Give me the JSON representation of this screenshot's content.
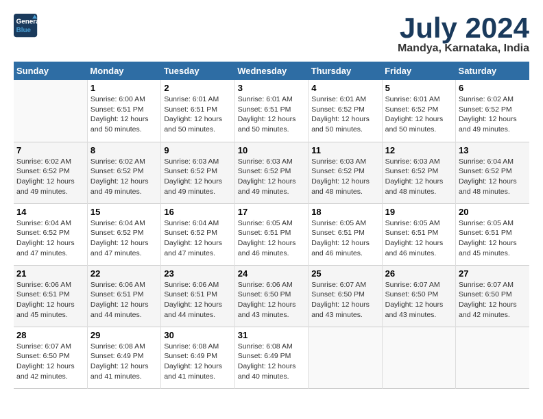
{
  "header": {
    "logo_line1": "General",
    "logo_line2": "Blue",
    "month": "July 2024",
    "location": "Mandya, Karnataka, India"
  },
  "days_of_week": [
    "Sunday",
    "Monday",
    "Tuesday",
    "Wednesday",
    "Thursday",
    "Friday",
    "Saturday"
  ],
  "weeks": [
    [
      {
        "day": "",
        "info": ""
      },
      {
        "day": "1",
        "info": "Sunrise: 6:00 AM\nSunset: 6:51 PM\nDaylight: 12 hours\nand 50 minutes."
      },
      {
        "day": "2",
        "info": "Sunrise: 6:01 AM\nSunset: 6:51 PM\nDaylight: 12 hours\nand 50 minutes."
      },
      {
        "day": "3",
        "info": "Sunrise: 6:01 AM\nSunset: 6:51 PM\nDaylight: 12 hours\nand 50 minutes."
      },
      {
        "day": "4",
        "info": "Sunrise: 6:01 AM\nSunset: 6:52 PM\nDaylight: 12 hours\nand 50 minutes."
      },
      {
        "day": "5",
        "info": "Sunrise: 6:01 AM\nSunset: 6:52 PM\nDaylight: 12 hours\nand 50 minutes."
      },
      {
        "day": "6",
        "info": "Sunrise: 6:02 AM\nSunset: 6:52 PM\nDaylight: 12 hours\nand 49 minutes."
      }
    ],
    [
      {
        "day": "7",
        "info": "Sunrise: 6:02 AM\nSunset: 6:52 PM\nDaylight: 12 hours\nand 49 minutes."
      },
      {
        "day": "8",
        "info": "Sunrise: 6:02 AM\nSunset: 6:52 PM\nDaylight: 12 hours\nand 49 minutes."
      },
      {
        "day": "9",
        "info": "Sunrise: 6:03 AM\nSunset: 6:52 PM\nDaylight: 12 hours\nand 49 minutes."
      },
      {
        "day": "10",
        "info": "Sunrise: 6:03 AM\nSunset: 6:52 PM\nDaylight: 12 hours\nand 49 minutes."
      },
      {
        "day": "11",
        "info": "Sunrise: 6:03 AM\nSunset: 6:52 PM\nDaylight: 12 hours\nand 48 minutes."
      },
      {
        "day": "12",
        "info": "Sunrise: 6:03 AM\nSunset: 6:52 PM\nDaylight: 12 hours\nand 48 minutes."
      },
      {
        "day": "13",
        "info": "Sunrise: 6:04 AM\nSunset: 6:52 PM\nDaylight: 12 hours\nand 48 minutes."
      }
    ],
    [
      {
        "day": "14",
        "info": "Sunrise: 6:04 AM\nSunset: 6:52 PM\nDaylight: 12 hours\nand 47 minutes."
      },
      {
        "day": "15",
        "info": "Sunrise: 6:04 AM\nSunset: 6:52 PM\nDaylight: 12 hours\nand 47 minutes."
      },
      {
        "day": "16",
        "info": "Sunrise: 6:04 AM\nSunset: 6:52 PM\nDaylight: 12 hours\nand 47 minutes."
      },
      {
        "day": "17",
        "info": "Sunrise: 6:05 AM\nSunset: 6:51 PM\nDaylight: 12 hours\nand 46 minutes."
      },
      {
        "day": "18",
        "info": "Sunrise: 6:05 AM\nSunset: 6:51 PM\nDaylight: 12 hours\nand 46 minutes."
      },
      {
        "day": "19",
        "info": "Sunrise: 6:05 AM\nSunset: 6:51 PM\nDaylight: 12 hours\nand 46 minutes."
      },
      {
        "day": "20",
        "info": "Sunrise: 6:05 AM\nSunset: 6:51 PM\nDaylight: 12 hours\nand 45 minutes."
      }
    ],
    [
      {
        "day": "21",
        "info": "Sunrise: 6:06 AM\nSunset: 6:51 PM\nDaylight: 12 hours\nand 45 minutes."
      },
      {
        "day": "22",
        "info": "Sunrise: 6:06 AM\nSunset: 6:51 PM\nDaylight: 12 hours\nand 44 minutes."
      },
      {
        "day": "23",
        "info": "Sunrise: 6:06 AM\nSunset: 6:51 PM\nDaylight: 12 hours\nand 44 minutes."
      },
      {
        "day": "24",
        "info": "Sunrise: 6:06 AM\nSunset: 6:50 PM\nDaylight: 12 hours\nand 43 minutes."
      },
      {
        "day": "25",
        "info": "Sunrise: 6:07 AM\nSunset: 6:50 PM\nDaylight: 12 hours\nand 43 minutes."
      },
      {
        "day": "26",
        "info": "Sunrise: 6:07 AM\nSunset: 6:50 PM\nDaylight: 12 hours\nand 43 minutes."
      },
      {
        "day": "27",
        "info": "Sunrise: 6:07 AM\nSunset: 6:50 PM\nDaylight: 12 hours\nand 42 minutes."
      }
    ],
    [
      {
        "day": "28",
        "info": "Sunrise: 6:07 AM\nSunset: 6:50 PM\nDaylight: 12 hours\nand 42 minutes."
      },
      {
        "day": "29",
        "info": "Sunrise: 6:08 AM\nSunset: 6:49 PM\nDaylight: 12 hours\nand 41 minutes."
      },
      {
        "day": "30",
        "info": "Sunrise: 6:08 AM\nSunset: 6:49 PM\nDaylight: 12 hours\nand 41 minutes."
      },
      {
        "day": "31",
        "info": "Sunrise: 6:08 AM\nSunset: 6:49 PM\nDaylight: 12 hours\nand 40 minutes."
      },
      {
        "day": "",
        "info": ""
      },
      {
        "day": "",
        "info": ""
      },
      {
        "day": "",
        "info": ""
      }
    ]
  ]
}
